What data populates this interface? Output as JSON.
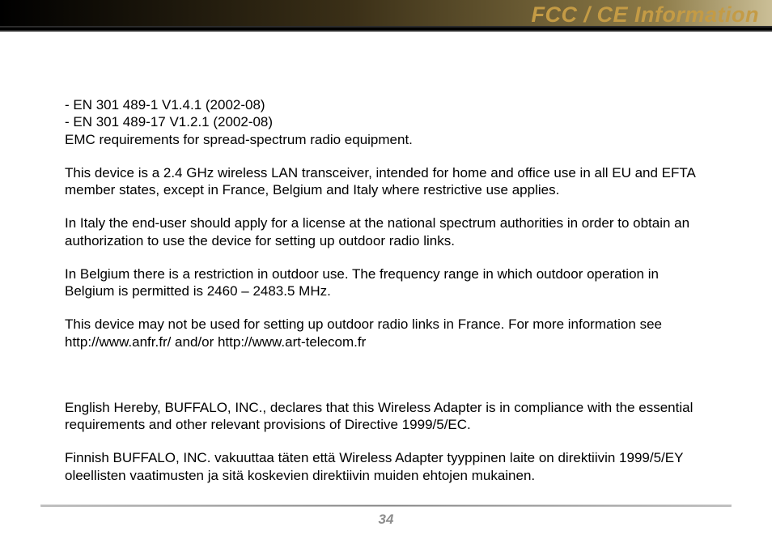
{
  "header": {
    "title": "FCC / CE Information"
  },
  "body": {
    "line1": "- EN 301 489-1 V1.4.1 (2002-08)",
    "line2": "- EN 301 489-17 V1.2.1 (2002-08)",
    "line3": "EMC requirements for spread-spectrum radio equipment.",
    "para2": "This device is a 2.4 GHz wireless LAN transceiver, intended for home and office use in all EU and EFTA member states, except in France, Belgium and Italy where restrictive use applies.",
    "para3": "In Italy the end-user should apply for a license at the national spectrum authorities in order to obtain an authorization to use the device for setting up outdoor radio links.",
    "para4": "In Belgium there is a restriction in outdoor use. The frequency range in which outdoor operation in Belgium is permitted is 2460 – 2483.5 MHz.",
    "para5": "This device may not be used for setting up outdoor radio links in France. For more information see http://www.anfr.fr/ and/or http://www.art-telecom.fr",
    "para6": "English   Hereby, BUFFALO, INC., declares that this Wireless Adapter is in compliance with the essential requirements and other relevant provisions of Directive 1999/5/EC.",
    "para7": "Finnish   BUFFALO, INC. vakuuttaa täten että Wireless Adapter tyyppinen laite on direktiivin 1999/5/EY oleellisten vaatimusten ja sitä koskevien direktiivin muiden ehtojen mukainen."
  },
  "footer": {
    "page_number": "34"
  }
}
